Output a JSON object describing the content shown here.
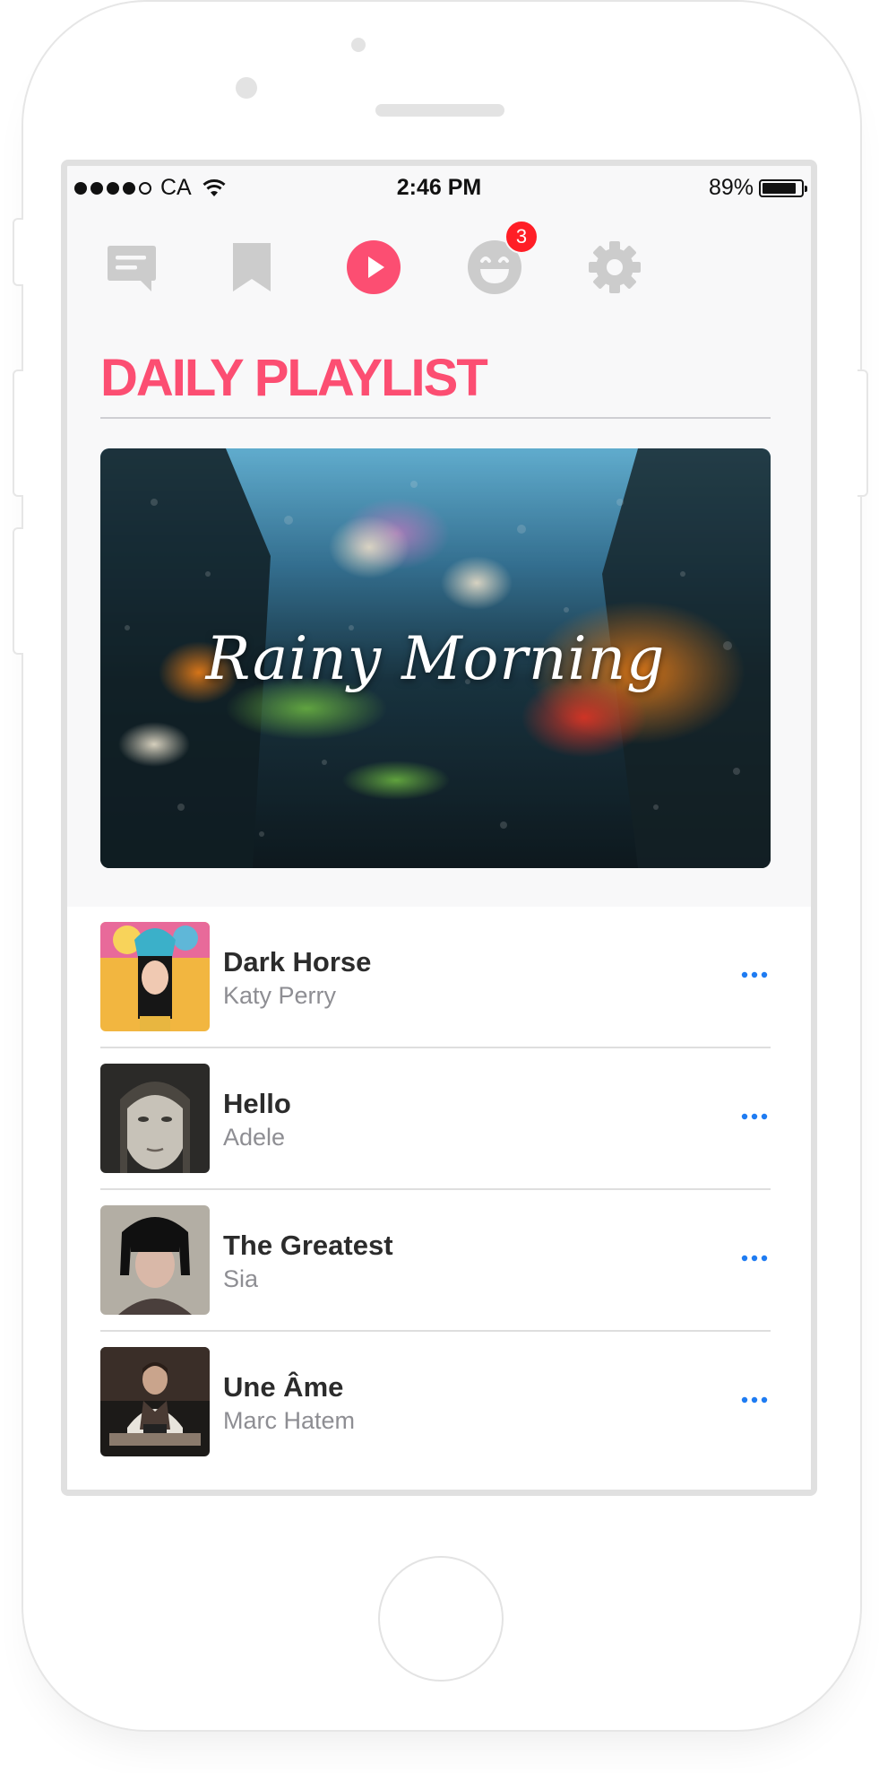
{
  "status_bar": {
    "carrier": "CA",
    "time": "2:46 PM",
    "battery_text": "89%",
    "battery_level": 0.89
  },
  "navbar": {
    "icons": [
      "chat-icon",
      "bookmark-icon",
      "play-icon",
      "smiley-icon",
      "gear-icon"
    ],
    "active": "play-icon",
    "notification_badge": "3"
  },
  "colors": {
    "accent": "#fc4e72",
    "inactive_icon": "#cccccc",
    "badge": "#ff1e26",
    "link_blue": "#1f7cf2"
  },
  "page": {
    "title": "DAILY PLAYLIST"
  },
  "hero": {
    "title": "Rainy Morning"
  },
  "songs": [
    {
      "title": "Dark Horse",
      "artist": "Katy Perry"
    },
    {
      "title": "Hello",
      "artist": "Adele"
    },
    {
      "title": "The Greatest",
      "artist": "Sia"
    },
    {
      "title": "Une Âme",
      "artist": "Marc Hatem"
    }
  ]
}
